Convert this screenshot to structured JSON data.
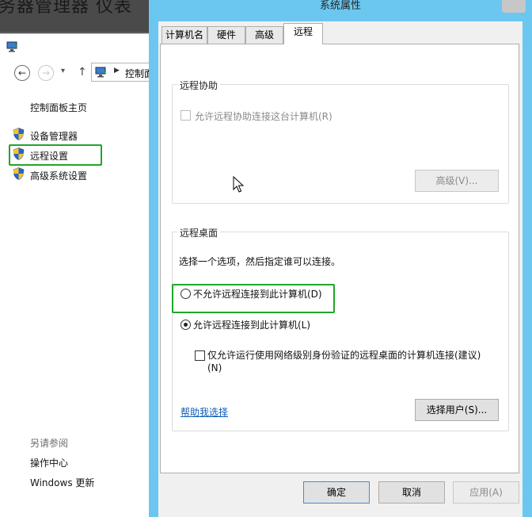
{
  "background_window": {
    "title_fragment": "务器管理器  仪表"
  },
  "control_panel": {
    "address_text": "控制面",
    "nav_back_glyph": "←",
    "nav_forward_glyph": "→",
    "nav_dropdown_glyph": "▾",
    "nav_up_glyph": "↑",
    "home_link": "控制面板主页",
    "links": [
      {
        "label": "设备管理器",
        "icon": "shield-icon"
      },
      {
        "label": "远程设置",
        "icon": "shield-icon"
      },
      {
        "label": "高级系统设置",
        "icon": "shield-icon"
      }
    ],
    "see_also_title": "另请参阅",
    "see_also": [
      "操作中心",
      "Windows 更新"
    ]
  },
  "dialog": {
    "title": "系统属性",
    "tabs": [
      "计算机名",
      "硬件",
      "高级",
      "远程"
    ],
    "active_tab": "远程",
    "remote_assistance": {
      "group_title": "远程协助",
      "allow_checkbox_label": "允许远程协助连接这台计算机(R)",
      "advanced_button": "高级(V)..."
    },
    "remote_desktop": {
      "group_title": "远程桌面",
      "instruction": "选择一个选项，然后指定谁可以连接。",
      "option_disallow": "不允许远程连接到此计算机(D)",
      "option_allow": "允许远程连接到此计算机(L)",
      "nla_checkbox_line1": "仅允许运行使用网络级别身份验证的远程桌面的计算机连接(建议)",
      "nla_checkbox_line2": "(N)",
      "help_link": "帮助我选择",
      "select_users_button": "选择用户(S)..."
    },
    "buttons": {
      "ok": "确定",
      "cancel": "取消",
      "apply": "应用(A)"
    }
  },
  "colors": {
    "highlight_box": "#22a52b",
    "dialog_frame": "#6cc7f0",
    "link": "#0f5fb5"
  }
}
